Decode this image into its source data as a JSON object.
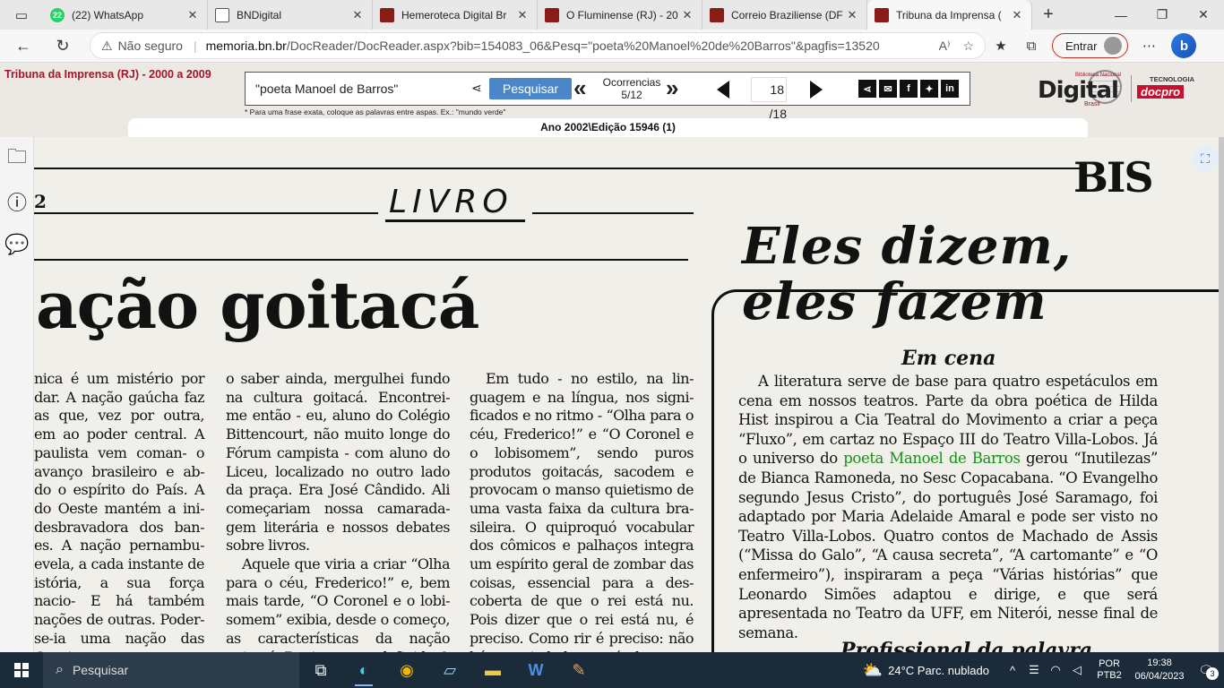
{
  "browser": {
    "tabs": [
      {
        "title": "(22) WhatsApp",
        "badge": "22",
        "icon": "whatsapp-icon"
      },
      {
        "title": "BNDigital",
        "icon": "document-icon"
      },
      {
        "title": "Hemeroteca Digital Br",
        "icon": "bn-icon"
      },
      {
        "title": "O Fluminense (RJ) - 20",
        "icon": "bn-icon"
      },
      {
        "title": "Correio Braziliense (DF",
        "icon": "bn-icon"
      },
      {
        "title": "Tribuna da Imprensa (",
        "icon": "bn-icon",
        "active": true
      }
    ],
    "address": {
      "security": "Não seguro",
      "host": "memoria.bn.br",
      "path": "/DocReader/DocReader.aspx?bib=154083_06&Pesq=\"poeta%20Manoel%20de%20Barros\"&pagfis=13520"
    },
    "signin_label": "Entrar"
  },
  "site": {
    "collection_title": "Tribuna da Imprensa (RJ) - 2000 a 2009",
    "search": {
      "query": "\"poeta Manoel de Barros\"",
      "button": "Pesquisar",
      "occurrences_label": "Ocorrencias",
      "occurrences_value": "5/12",
      "hint": "* Para uma frase exata, coloque as palavras entre aspas. Ex.: \"mundo verde\""
    },
    "pager": {
      "current": "18",
      "total": "/18"
    },
    "social": [
      "f"
    ],
    "logo": {
      "main": "Digital",
      "top": "Biblioteca Nacional",
      "bottom": "Brasil"
    },
    "partner": {
      "tag": "TECNOLOGIA",
      "name": "docpro"
    },
    "edition": "Ano 2002\\Edição 15946 (1)"
  },
  "newspaper": {
    "page_number": "2",
    "section_left": "LIVRO",
    "section_right": "BIS",
    "headline_left": "ação goitacá",
    "col1": "nica é um mistério por dar. A nação gaúcha faz as que, vez por outra, em ao poder central. A paulista vem coman- o avanço brasileiro e ab- do o espírito do País. A do Oeste mantém a ini- desbravadora dos ban- es. A nação pernambu- evela, a cada instante de istória, a sua força nacio- E há também nações de outras. Poder-se-ia uma nação das Gerais e",
    "col2a": "o saber ainda, mergulhei fundo na cultura goitacá. Encontrei- me então - eu, aluno do Colégio Bittencourt, não muito longe do Fórum campista - com aluno do Liceu, localizado no outro lado da praça. Era José Cândido. Ali começariam nossa camarada- gem literária e nossos debates sobre livros.",
    "col2b": "Aquele que viria a criar “Olha para o céu, Frederico!” e, bem mais tarde, “O Coronel e o lobi- somem” exibia, desde o começo, as características da nação goitacá. Bonito: como defini-las?",
    "col3": "Em tudo - no estilo, na lin- guagem e na língua, nos signi- ficados e no ritmo - “Olha para o céu, Frederico!” e “O Coronel e o lobisomem”, sendo puros produtos goitacás, sacodem e provocam o manso quietismo de uma vasta faixa da cultura bra- sileira. O quiproquó vocabular dos cômicos e palhaços integra um espírito geral de zombar das coisas, essencial para a des- coberta de que o rei está nu. Pois dizer que o rei está nu, é preciso. Como rir é preciso: não há se- riedade possível sem a capa-",
    "headline_right_1": "Eles dizem,",
    "headline_right_2": "eles fazem",
    "subhead": "Em cena",
    "right_text_before": "A literatura serve de base para quatro espetáculos em cena em nossos teatros. Parte da obra poética de Hilda Hist inspirou a Cia Teatral do Movimento a criar a peça “Fluxo”, em cartaz no Espaço III do Teatro Villa-Lobos. Já o universo do ",
    "right_text_highlight": "poeta Manoel de Barros",
    "right_text_after": " gerou “Inutilezas” de Bianca Ramoneda, no Sesc Copacabana. “O Evangelho segundo Jesus Cristo”, do português José Saramago, foi adaptado por Maria Adelaide Amaral e pode ser visto no Teatro Villa-Lobos. Quatro contos de Machado de Assis (“Missa do Galo”, “A causa secreta”, “A cartomante” e “O enfermeiro”), inspiraram a peça “Várias histórias” que Leonardo Simões adaptou e dirige, e que será apresentada no Teatro da UFF, em Niterói, nesse final de semana.",
    "subhead2": "Profissional da palavra"
  },
  "taskbar": {
    "search_label": "Pesquisar",
    "weather": "24°C  Parc. nublado",
    "lang_1": "POR",
    "lang_2": "PTB2",
    "time": "19:38",
    "date": "06/04/2023",
    "notifications": "3"
  }
}
